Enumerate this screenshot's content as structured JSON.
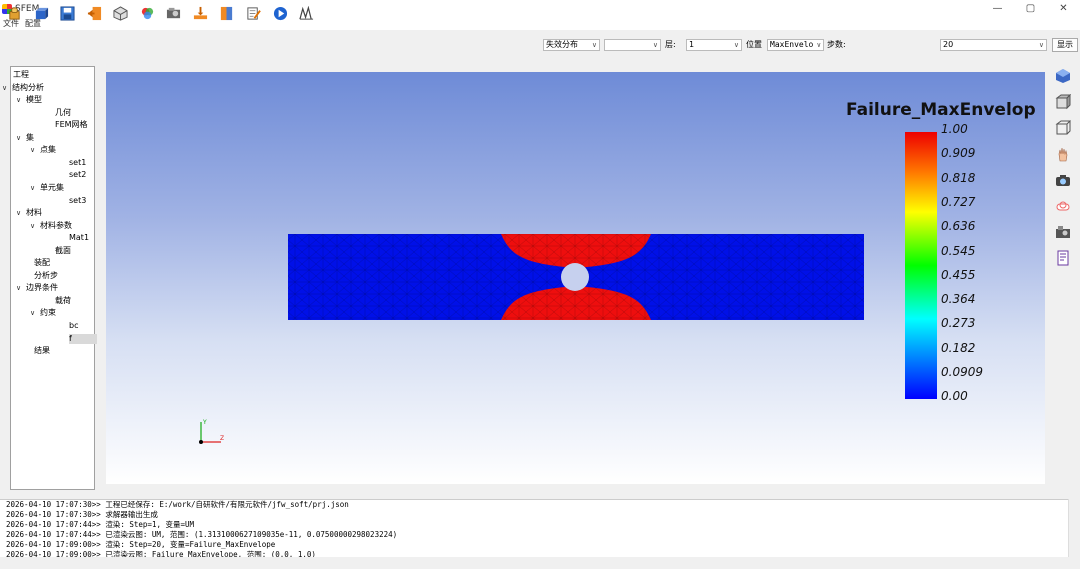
{
  "window": {
    "title": "SFEM",
    "min": "—",
    "max": "▢",
    "close": "✕"
  },
  "menu": [
    "文件",
    "配置"
  ],
  "toolbar": {
    "icons": [
      "open-project-icon",
      "save-model-icon",
      "save-icon",
      "import-icon",
      "mesh-icon",
      "material-icon",
      "solver-icon",
      "load-icon",
      "book-icon",
      "edit-icon",
      "play-icon",
      "chart-icon"
    ],
    "result_type": "失效分布",
    "result_sub": "",
    "layer_label": "层:",
    "layer_value": "1",
    "position_label": "位置",
    "position_value": "MaxEnvelo",
    "step_label": "步数:",
    "step_value": "20",
    "show_button": "显示"
  },
  "tree": [
    {
      "label": "工程",
      "level": 0,
      "chev": ""
    },
    {
      "label": "结构分析",
      "level": 0,
      "chev": "∨"
    },
    {
      "label": "模型",
      "level": 1,
      "chev": "∨"
    },
    {
      "label": "几何",
      "level": 3,
      "chev": ""
    },
    {
      "label": "FEM网格",
      "level": 3,
      "chev": ""
    },
    {
      "label": "集",
      "level": 1,
      "chev": "∨"
    },
    {
      "label": "点集",
      "level": 2,
      "chev": "∨"
    },
    {
      "label": "set1",
      "level": 4,
      "chev": ""
    },
    {
      "label": "set2",
      "level": 4,
      "chev": ""
    },
    {
      "label": "单元集",
      "level": 2,
      "chev": "∨"
    },
    {
      "label": "set3",
      "level": 4,
      "chev": ""
    },
    {
      "label": "材料",
      "level": 1,
      "chev": "∨"
    },
    {
      "label": "材料参数",
      "level": 2,
      "chev": "∨"
    },
    {
      "label": "Mat1",
      "level": 4,
      "chev": ""
    },
    {
      "label": "截面",
      "level": 3,
      "chev": ""
    },
    {
      "label": "装配",
      "level": 1.5,
      "chev": ""
    },
    {
      "label": "分析步",
      "level": 1.5,
      "chev": ""
    },
    {
      "label": "边界条件",
      "level": 1,
      "chev": "∨"
    },
    {
      "label": "载荷",
      "level": 3,
      "chev": ""
    },
    {
      "label": "约束",
      "level": 2,
      "chev": "∨"
    },
    {
      "label": "bc",
      "level": 4,
      "chev": ""
    },
    {
      "label": "f",
      "level": 4,
      "chev": "",
      "selected": true
    },
    {
      "label": "结果",
      "level": 1.5,
      "chev": ""
    }
  ],
  "legend": {
    "title": "Failure_MaxEnvelop",
    "labels": [
      "1.00",
      "0.909",
      "0.818",
      "0.727",
      "0.636",
      "0.545",
      "0.455",
      "0.364",
      "0.273",
      "0.182",
      "0.0909",
      "0.00"
    ]
  },
  "axes": {
    "y": "Y",
    "x": "Z"
  },
  "colors": {
    "low": "#0010e8",
    "high": "#ee0e0e"
  },
  "righttools": [
    "view-iso-icon",
    "view-front-icon",
    "view-wire-icon",
    "hand-icon",
    "camera-icon",
    "eraser-icon",
    "screenshot-icon",
    "report-icon"
  ],
  "console": [
    "2026-04-10 17:07:30>> 工程已经保存: E:/work/自研软件/有限元软件/jfw_soft/prj.json",
    "2026-04-10 17:07:30>> 求解器输出生成",
    "2026-04-10 17:07:44>> 渲染: Step=1, 变量=UM",
    "2026-04-10 17:07:44>> 已渲染云图: UM, 范围: (1.3131000627109035e-11, 0.07500000298023224)",
    "2026-04-10 17:09:00>> 渲染: Step=20, 变量=Failure_MaxEnvelope",
    "2026-04-10 17:09:00>> 已渲染云图: Failure_MaxEnvelope, 范围: (0.0, 1.0)"
  ]
}
